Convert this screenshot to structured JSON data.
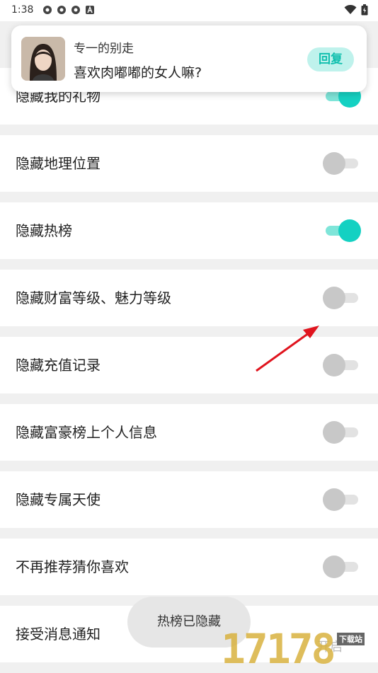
{
  "status_bar": {
    "time": "1:38"
  },
  "notification": {
    "sender": "专一的别走",
    "message": "喜欢肉嘟嘟的女人嘛?",
    "reply_label": "回复"
  },
  "settings": [
    {
      "label": "隐藏我的礼物",
      "on": true
    },
    {
      "label": "隐藏地理位置",
      "on": false
    },
    {
      "label": "隐藏热榜",
      "on": true
    },
    {
      "label": "隐藏财富等级、魅力等级",
      "on": false
    },
    {
      "label": "隐藏充值记录",
      "on": false
    },
    {
      "label": "隐藏富豪榜上个人信息",
      "on": false
    },
    {
      "label": "隐藏专属天使",
      "on": false
    },
    {
      "label": "不再推荐猜你喜欢",
      "on": false
    },
    {
      "label": "接受消息通知",
      "on": null
    }
  ],
  "toast": "热榜已隐藏",
  "watermark": {
    "text": "17178",
    "tag": "下载站",
    "behind_text": "开启"
  },
  "colors": {
    "accent": "#14d1c2",
    "accent_light": "#7fe5d9",
    "arrow": "#e0141e"
  }
}
